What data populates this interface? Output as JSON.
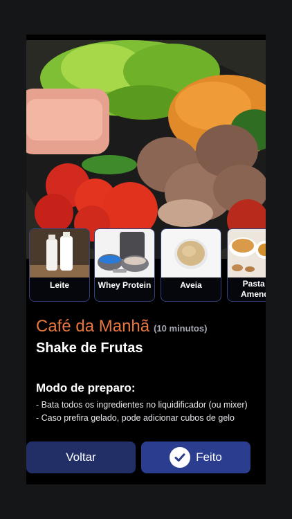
{
  "ingredients": [
    {
      "label_lines": [
        "Leite"
      ]
    },
    {
      "label_lines": [
        "Whey Protein"
      ]
    },
    {
      "label_lines": [
        "Aveia"
      ]
    },
    {
      "label_lines": [
        "Pasta d",
        "Amendo"
      ]
    }
  ],
  "meal": {
    "name": "Café da Manhã",
    "duration": "(10 minutos)",
    "recipe": "Shake de Frutas"
  },
  "preparation": {
    "title": "Modo de preparo:",
    "steps": [
      "- Bata todos os ingredientes no liquidificador (ou mixer)",
      "- Caso prefira gelado, pode adicionar cubos de gelo"
    ]
  },
  "buttons": {
    "back": "Voltar",
    "done": "Feito"
  },
  "colors": {
    "accent": "#e8773e",
    "button_back": "#222f66",
    "button_done": "#2a3d8e"
  },
  "icons": {
    "done": "check-circle-icon"
  }
}
